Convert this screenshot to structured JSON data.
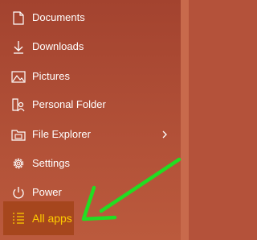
{
  "menu": {
    "items": [
      {
        "label": "Documents",
        "icon": "documents-icon"
      },
      {
        "label": "Downloads",
        "icon": "downloads-icon"
      },
      {
        "label": "Pictures",
        "icon": "pictures-icon"
      },
      {
        "label": "Personal Folder",
        "icon": "personal-folder-icon"
      },
      {
        "label": "File Explorer",
        "icon": "file-explorer-icon",
        "has_submenu": true
      },
      {
        "label": "Settings",
        "icon": "settings-icon"
      },
      {
        "label": "Power",
        "icon": "power-icon"
      }
    ],
    "all_apps": {
      "label": "All apps",
      "icon": "all-apps-icon"
    }
  },
  "colors": {
    "background": "#b4523a",
    "highlight_text": "#ffcc00",
    "highlight_bg": "#a6461d",
    "annotation_arrow": "#22dd22"
  }
}
